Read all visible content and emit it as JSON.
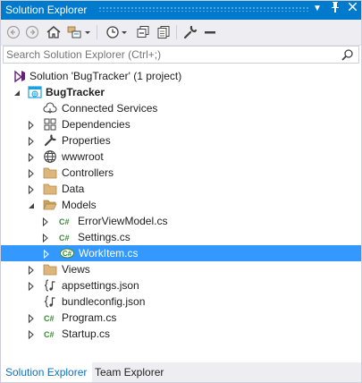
{
  "window": {
    "title": "Solution Explorer",
    "accent": "#007acc",
    "selection_color": "#3399ff"
  },
  "titlebar_buttons": [
    {
      "name": "dropdown-icon",
      "glyph": "▾"
    },
    {
      "name": "pin-icon",
      "glyph": "⊥"
    },
    {
      "name": "close-icon",
      "glyph": "✕"
    }
  ],
  "toolbar": {
    "icons": [
      "back-icon",
      "forward-icon",
      "home-icon",
      "switch-views-icon",
      "history-icon",
      "collapse-all-icon",
      "show-all-files-icon",
      "properties-icon",
      "preview-icon"
    ]
  },
  "search": {
    "placeholder": "Search Solution Explorer (Ctrl+;)"
  },
  "tree": {
    "items": [
      {
        "label": "Solution 'BugTracker' (1 project)",
        "icon": "solution-icon",
        "expander": "none"
      },
      {
        "label": "BugTracker",
        "icon": "web-project-icon",
        "expander": "expanded"
      },
      {
        "label": "Connected Services",
        "icon": "connected-services-icon",
        "expander": "none"
      },
      {
        "label": "Dependencies",
        "icon": "dependencies-icon",
        "expander": "collapsed"
      },
      {
        "label": "Properties",
        "icon": "wrench-icon",
        "expander": "collapsed"
      },
      {
        "label": "wwwroot",
        "icon": "globe-icon",
        "expander": "collapsed"
      },
      {
        "label": "Controllers",
        "icon": "folder-icon",
        "expander": "collapsed"
      },
      {
        "label": "Data",
        "icon": "folder-icon",
        "expander": "collapsed"
      },
      {
        "label": "Models",
        "icon": "folder-open-icon",
        "expander": "expanded"
      },
      {
        "label": "ErrorViewModel.cs",
        "icon": "csharp-file-icon",
        "expander": "collapsed"
      },
      {
        "label": "Settings.cs",
        "icon": "csharp-file-icon",
        "expander": "collapsed"
      },
      {
        "label": "WorkItem.cs",
        "icon": "csharp-file-icon",
        "expander": "collapsed",
        "selected": true
      },
      {
        "label": "Views",
        "icon": "folder-icon",
        "expander": "collapsed"
      },
      {
        "label": "appsettings.json",
        "icon": "json-file-icon",
        "expander": "collapsed"
      },
      {
        "label": "bundleconfig.json",
        "icon": "json-file-icon",
        "expander": "none"
      },
      {
        "label": "Program.cs",
        "icon": "csharp-file-icon",
        "expander": "collapsed"
      },
      {
        "label": "Startup.cs",
        "icon": "csharp-file-icon",
        "expander": "collapsed"
      }
    ]
  },
  "bottom_tabs": [
    {
      "label": "Solution Explorer",
      "active": true
    },
    {
      "label": "Team Explorer",
      "active": false
    }
  ]
}
